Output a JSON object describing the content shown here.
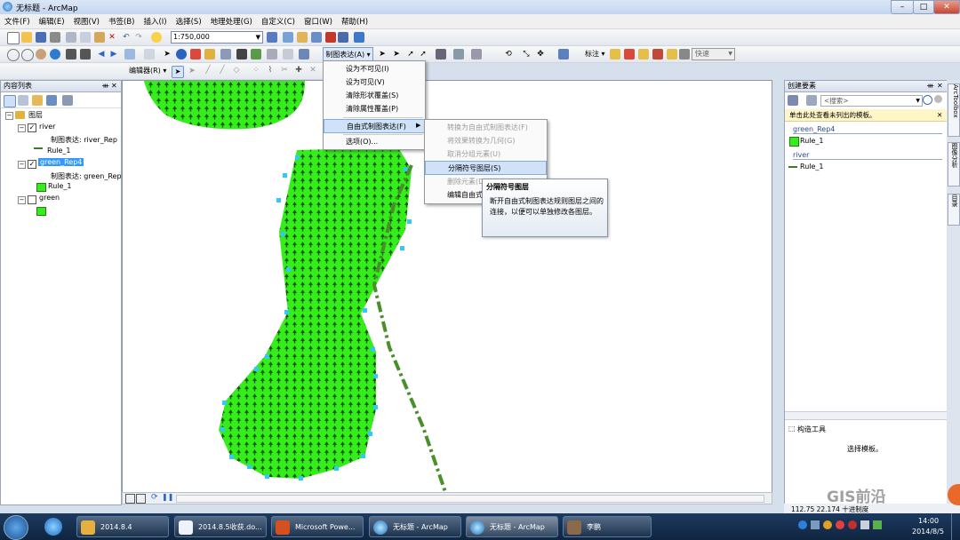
{
  "window": {
    "title": "无标题 - ArcMap"
  },
  "menubar": {
    "items": [
      "文件(F)",
      "编辑(E)",
      "视图(V)",
      "书签(B)",
      "插入(I)",
      "选择(S)",
      "地理处理(G)",
      "自定义(C)",
      "窗口(W)",
      "帮助(H)"
    ]
  },
  "toolbar": {
    "scale": "1:750,000",
    "rep_menu": "制图表达(A) ▾",
    "label_menu": "标注 ▾",
    "quick": "快速"
  },
  "editor": {
    "label": "编辑器(R) ▾"
  },
  "toc": {
    "title": "内容列表",
    "root": "图层",
    "layers": [
      {
        "name": "river",
        "rep_label": "制图表达: river_Rep",
        "rule": "Rule_1",
        "checked": true
      },
      {
        "name": "green_Rep4",
        "rep_label": "制图表达: green_Rep",
        "rule": "Rule_1",
        "checked": true
      },
      {
        "name": "green",
        "checked": false
      }
    ]
  },
  "context_menu": {
    "items": [
      "设为不可见(I)",
      "设为可见(V)",
      "清除形状覆盖(S)",
      "清除属性覆盖(P)",
      "自由式制图表达(F)",
      "选项(O)..."
    ]
  },
  "submenu": {
    "items": [
      "转换为自由式制图表达(F)",
      "将效果转换为几何(G)",
      "取消分组元素(U)",
      "分隔符号图层(S)",
      "删除元素(D)",
      "编辑自由式"
    ]
  },
  "tooltip": {
    "title": "分隔符号图层",
    "body": "断开自由式制图表达规则图层之间的连接，以便可以单独修改各图层。"
  },
  "create_features": {
    "title": "创建要素",
    "search": "<搜索>",
    "note": "单击此处查看未列出的模板。",
    "groups": [
      {
        "name": "green_Rep4",
        "rule": "Rule_1"
      },
      {
        "name": "river",
        "rule": "Rule_1"
      }
    ]
  },
  "construct_tools": {
    "title": "构造工具",
    "hint": "选择模板。"
  },
  "vertical_tabs": [
    "ArcToolbox",
    "图像分析",
    "目录"
  ],
  "status": {
    "coords": "112.75   22.174 十进制度"
  },
  "watermark": "GIS前沿",
  "taskbar": {
    "items": [
      "2014.8.4",
      "2014.8.5收获.do...",
      "Microsoft Powe...",
      "无标题 - ArcMap",
      "无标题 - ArcMap",
      "李鹏"
    ],
    "time": "14:00",
    "date": "2014/8/5"
  },
  "colors": {
    "polygon_fill": "#33ee1a",
    "river_line": "#4a8f2c",
    "vertex": "#33c8f5"
  }
}
